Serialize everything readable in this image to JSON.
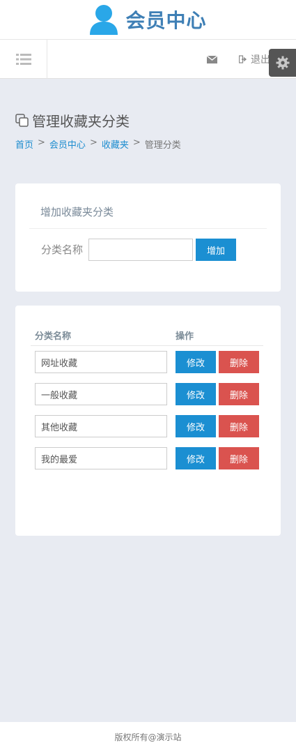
{
  "header": {
    "logo_text": "会员中心",
    "logout_label": "退出"
  },
  "page": {
    "title": "管理收藏夹分类",
    "breadcrumb": [
      "首页",
      "会员中心",
      "收藏夹",
      "管理分类"
    ],
    "breadcrumb_sep": ">"
  },
  "add_panel": {
    "title": "增加收藏夹分类",
    "name_label": "分类名称",
    "name_value": "",
    "add_button": "增加"
  },
  "list_panel": {
    "col_name": "分类名称",
    "col_ops": "操作",
    "rows": [
      {
        "name": "网址收藏",
        "edit": "修改",
        "delete": "删除"
      },
      {
        "name": "一般收藏",
        "edit": "修改",
        "delete": "删除"
      },
      {
        "name": "其他收藏",
        "edit": "修改",
        "delete": "删除"
      },
      {
        "name": "我的最爱",
        "edit": "修改",
        "delete": "删除"
      }
    ]
  },
  "footer": {
    "text": "版权所有@演示站"
  },
  "icons": {
    "avatar": "user-icon",
    "nav_toggle": "list-icon",
    "mail": "envelope-icon",
    "logout": "sign-out-icon",
    "settings": "gear-icon",
    "title": "copy-icon"
  },
  "colors": {
    "accent": "#1b8fd2",
    "danger": "#da534f",
    "brand": "#3e7fb5",
    "background": "#e8ebf2"
  }
}
